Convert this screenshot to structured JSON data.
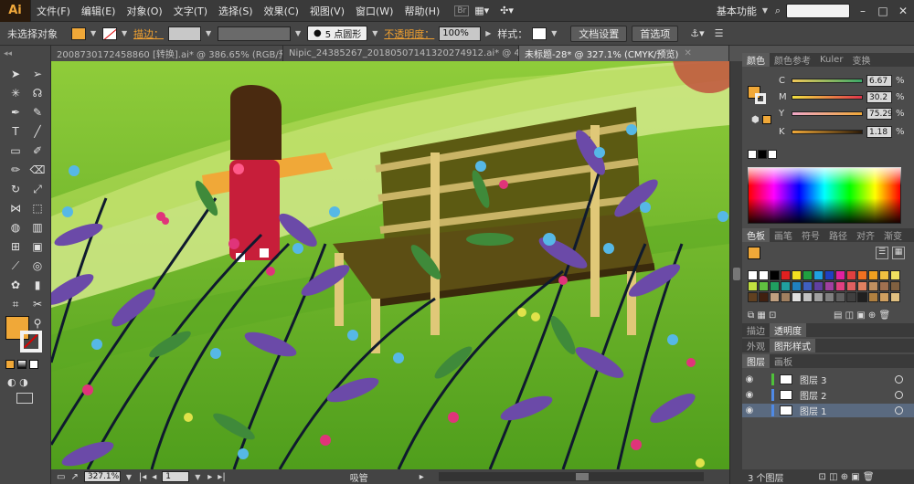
{
  "app": {
    "logo": "Ai"
  },
  "menu": [
    "文件(F)",
    "编辑(E)",
    "对象(O)",
    "文字(T)",
    "选择(S)",
    "效果(C)",
    "视图(V)",
    "窗口(W)",
    "帮助(H)"
  ],
  "workspace": "基本功能",
  "control": {
    "selection_label": "未选择对象",
    "stroke_label": "描边：",
    "brush_label": "5 点圆形",
    "opacity_label": "不透明度：",
    "opacity_value": "100%",
    "style_label": "样式：",
    "doc_settings": "文档设置",
    "preferences": "首选项",
    "fill_color": "#f0a838"
  },
  "tabs": [
    {
      "label": "2008730172458860 [转换].ai* @ 386.65% (RGB/预...",
      "active": false
    },
    {
      "label": "Nipic_24385267_20180507141320274912.ai* @ 436...",
      "active": false
    },
    {
      "label": "未标题-28* @ 327.1% (CMYK/预览)",
      "active": true
    }
  ],
  "status": {
    "zoom": "327.1%",
    "page": "1",
    "tool_name": "吸管"
  },
  "color_panel": {
    "tabs": [
      "颜色",
      "颜色参考",
      "Kuler",
      "变换"
    ],
    "channels": [
      {
        "label": "C",
        "value": "6.67"
      },
      {
        "label": "M",
        "value": "30.2"
      },
      {
        "label": "Y",
        "value": "75.29"
      },
      {
        "label": "K",
        "value": "1.18"
      }
    ],
    "pct": "%"
  },
  "swatches_panel": {
    "tabs": [
      "色板",
      "画笔",
      "符号",
      "路径",
      "对齐",
      "渐变"
    ]
  },
  "stroke_panel": {
    "tabs": [
      "描边",
      "透明度"
    ]
  },
  "appearance_panel": {
    "tabs": [
      "外观",
      "图形样式"
    ]
  },
  "layers_panel": {
    "tabs": [
      "图层",
      "画板"
    ],
    "layers": [
      {
        "name": "图层 3",
        "color": "#4fc13a"
      },
      {
        "name": "图层 2",
        "color": "#4f8ae6"
      },
      {
        "name": "图层 1",
        "color": "#4f8ae6"
      }
    ],
    "count_label": "3 个图层"
  }
}
